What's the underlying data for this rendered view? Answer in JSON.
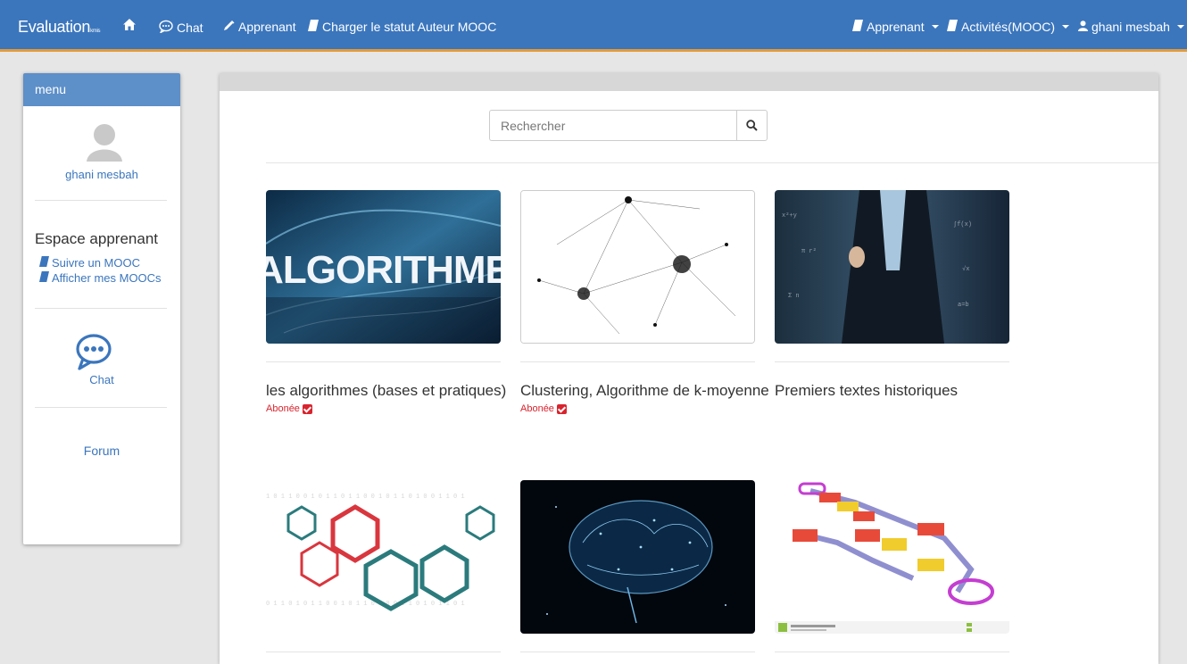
{
  "navbar": {
    "brand": "Evaluation",
    "brand_sub": "kmis",
    "home_icon": "home-icon",
    "chat": "Chat",
    "apprenant": "Apprenant",
    "charger": "Charger le statut Auteur MOOC",
    "right_apprenant": "Apprenant",
    "activites": "Activités(MOOC)",
    "user": "ghani mesbah",
    "bg_color": "#3b76bd",
    "accent_color": "#e39b3b"
  },
  "sidebar": {
    "header": "menu",
    "user_name": "ghani mesbah",
    "section_title": "Espace apprenant",
    "links": [
      "Suivre un MOOC",
      "Afficher mes MOOCs"
    ],
    "chat": "Chat",
    "forum": "Forum"
  },
  "search": {
    "placeholder": "Rechercher"
  },
  "courses": [
    {
      "title": "les algorithmes (bases et pratiques)",
      "badge": "Abonée",
      "thumb_text": "ALGORITHME"
    },
    {
      "title": "Clustering, Algorithme de k-moyenne",
      "badge": "Abonée"
    },
    {
      "title": "Premiers textes historiques"
    },
    {
      "title": ""
    },
    {
      "title": ""
    },
    {
      "title": ""
    }
  ],
  "badge_color": "#d9232d"
}
